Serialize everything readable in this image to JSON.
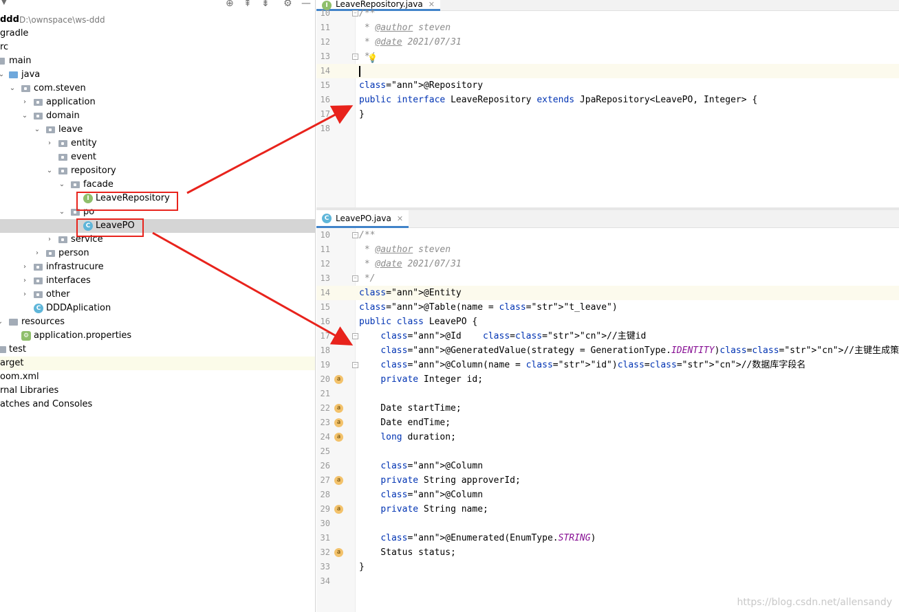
{
  "project": {
    "root_name": "ddd",
    "root_path": "D:\\ownspace\\ws-ddd",
    "tree": [
      {
        "label": "gradle"
      },
      {
        "label": "rc"
      },
      {
        "label": "main"
      },
      {
        "label": "java"
      },
      {
        "label": "com.steven"
      },
      {
        "label": "application"
      },
      {
        "label": "domain"
      },
      {
        "label": "leave"
      },
      {
        "label": "entity"
      },
      {
        "label": "event"
      },
      {
        "label": "repository"
      },
      {
        "label": "facade"
      },
      {
        "label": "LeaveRepository"
      },
      {
        "label": "po"
      },
      {
        "label": "LeavePO"
      },
      {
        "label": "service"
      },
      {
        "label": "person"
      },
      {
        "label": "infrastrucure"
      },
      {
        "label": "interfaces"
      },
      {
        "label": "other"
      },
      {
        "label": "DDDAplication"
      },
      {
        "label": "resources"
      },
      {
        "label": "application.properties"
      },
      {
        "label": "test"
      },
      {
        "label": "arget"
      },
      {
        "label": "oom.xml"
      },
      {
        "label": "rnal Libraries"
      },
      {
        "label": "atches and Consoles"
      }
    ]
  },
  "editor_top": {
    "tab_label": "LeaveRepository.java",
    "lines": [
      {
        "n": "10",
        "text": "/**"
      },
      {
        "n": "11",
        "text": " * @author steven"
      },
      {
        "n": "12",
        "text": " * @date 2021/07/31"
      },
      {
        "n": "13",
        "text": " */"
      },
      {
        "n": "14",
        "text": ""
      },
      {
        "n": "15",
        "text": "@Repository"
      },
      {
        "n": "16",
        "text": "public interface LeaveRepository extends JpaRepository<LeavePO, Integer> {"
      },
      {
        "n": "17",
        "text": "}"
      },
      {
        "n": "18",
        "text": ""
      }
    ]
  },
  "editor_bottom": {
    "tab_label": "LeavePO.java",
    "lines": [
      {
        "n": "10",
        "text": "/**"
      },
      {
        "n": "11",
        "text": " * @author steven"
      },
      {
        "n": "12",
        "text": " * @date 2021/07/31"
      },
      {
        "n": "13",
        "text": " */"
      },
      {
        "n": "14",
        "text": "@Entity"
      },
      {
        "n": "15",
        "text": "@Table(name = \"t_leave\")"
      },
      {
        "n": "16",
        "text": "public class LeavePO {"
      },
      {
        "n": "17",
        "text": "    @Id    //主键id"
      },
      {
        "n": "18",
        "text": "    @GeneratedValue(strategy = GenerationType.IDENTITY)//主键生成策略"
      },
      {
        "n": "19",
        "text": "    @Column(name = \"id\")//数据库字段名"
      },
      {
        "n": "20",
        "text": "    private Integer id;"
      },
      {
        "n": "21",
        "text": ""
      },
      {
        "n": "22",
        "text": "    Date startTime;"
      },
      {
        "n": "23",
        "text": "    Date endTime;"
      },
      {
        "n": "24",
        "text": "    long duration;"
      },
      {
        "n": "25",
        "text": ""
      },
      {
        "n": "26",
        "text": "    @Column"
      },
      {
        "n": "27",
        "text": "    private String approverId;"
      },
      {
        "n": "28",
        "text": "    @Column"
      },
      {
        "n": "29",
        "text": "    private String name;"
      },
      {
        "n": "30",
        "text": ""
      },
      {
        "n": "31",
        "text": "    @Enumerated(EnumType.STRING)"
      },
      {
        "n": "32",
        "text": "    Status status;"
      },
      {
        "n": "33",
        "text": "}"
      },
      {
        "n": "34",
        "text": ""
      }
    ]
  },
  "watermark": "https://blog.csdn.net/allensandy",
  "colors": {
    "annotation_box": "#e8231c",
    "tab_underline": "#4083c9",
    "selected_row": "#d5d5d5"
  },
  "icons": [
    "locate-icon",
    "collapse-icon",
    "expand-icon",
    "gear-icon",
    "minimize-icon",
    "interface-icon",
    "class-icon",
    "folder-icon",
    "package-icon",
    "bulb-icon",
    "field-icon"
  ]
}
